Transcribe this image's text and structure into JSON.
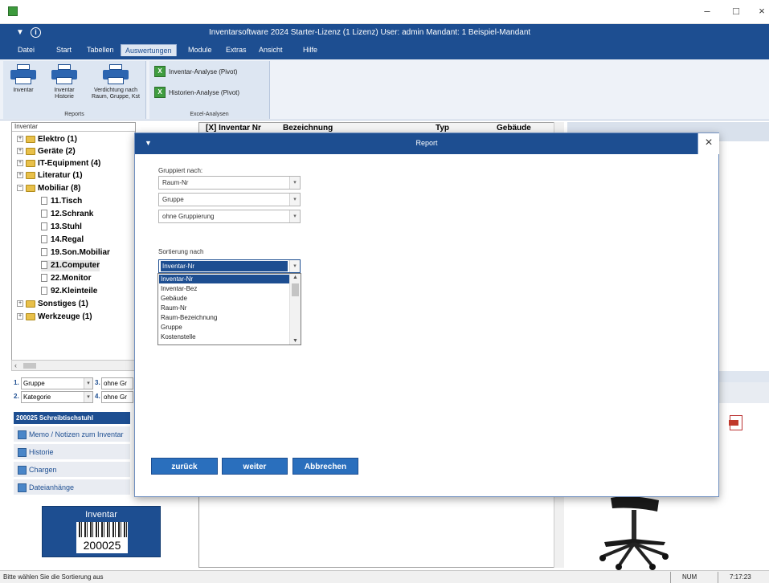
{
  "window": {
    "title": "Inventarsoftware 2024 Starter-Lizenz (1 Lizenz)   User: admin   Mandant: 1 Beispiel-Mandant",
    "minimize_glyph": "–",
    "maximize_glyph": "□",
    "close_glyph": "×"
  },
  "menu": {
    "items": [
      "Datei",
      "Start",
      "Tabellen",
      "Auswertungen",
      "Module",
      "Extras",
      "Ansicht",
      "Hilfe"
    ],
    "active": "Auswertungen"
  },
  "ribbon": {
    "reports": {
      "buttons": [
        {
          "label": "Inventar",
          "icon": "printer-icon"
        },
        {
          "label": "Inventar\nHistorie",
          "icon": "printer-icon"
        },
        {
          "label": "Verdichtung nach\nRaum, Gruppe, Kst",
          "icon": "printer-icon"
        }
      ],
      "group_label": "Reports"
    },
    "excel": {
      "buttons": [
        {
          "label": "Inventar-Analyse (Pivot)",
          "icon": "excel-icon"
        },
        {
          "label": "Historien-Analyse (Pivot)",
          "icon": "excel-icon"
        }
      ],
      "group_label": "Excel-Analysen"
    }
  },
  "tree": {
    "header": "Inventar",
    "nodes": [
      {
        "label": "Elektro  (1)",
        "level": 0,
        "expander": "+"
      },
      {
        "label": "Geräte  (2)",
        "level": 0,
        "expander": "+"
      },
      {
        "label": "IT-Equipment  (4)",
        "level": 0,
        "expander": "+"
      },
      {
        "label": "Literatur  (1)",
        "level": 0,
        "expander": "+"
      },
      {
        "label": "Mobiliar  (8)",
        "level": 0,
        "expander": "−"
      },
      {
        "label": "11.Tisch",
        "level": 1
      },
      {
        "label": "12.Schrank",
        "level": 1
      },
      {
        "label": "13.Stuhl",
        "level": 1
      },
      {
        "label": "14.Regal",
        "level": 1
      },
      {
        "label": "19.Son.Mobiliar",
        "level": 1
      },
      {
        "label": "21.Computer",
        "level": 1
      },
      {
        "label": "22.Monitor",
        "level": 1
      },
      {
        "label": "92.Kleinteile",
        "level": 1
      },
      {
        "label": "Sonstiges  (1)",
        "level": 0,
        "expander": "+"
      },
      {
        "label": "Werkzeuge  (1)",
        "level": 0,
        "expander": "+"
      }
    ]
  },
  "grouping": {
    "g1": {
      "num": "1.",
      "value": "Gruppe"
    },
    "g2": {
      "num": "2.",
      "value": "Kategorie"
    },
    "g3": {
      "num": "3.",
      "value": "ohne Gr"
    },
    "g4": {
      "num": "4.",
      "value": "ohne Gr"
    }
  },
  "detail": {
    "header": "200025 Schreibtischstuhl",
    "links": [
      "Memo / Notizen zum Inventar",
      "Historie",
      "Chargen",
      "Dateianhänge"
    ]
  },
  "barcode": {
    "title": "Inventar",
    "number": "200025"
  },
  "grid": {
    "columns": [
      "[X] Inventar Nr",
      "Bezeichnung",
      "Typ",
      "Gebäude"
    ]
  },
  "modal": {
    "title": "Report",
    "grouping_label": "Gruppiert nach:",
    "group_selects": [
      "Raum-Nr",
      "Gruppe",
      "ohne Gruppierung"
    ],
    "sort_label": "Sortierung nach",
    "sort_value": "Inventar-Nr",
    "sort_options": [
      "Inventar-Nr",
      "Inventar-Bez",
      "Gebäude",
      "Raum-Nr",
      "Raum-Bezeichnung",
      "Gruppe",
      "Kostenstelle"
    ],
    "buttons": {
      "back": "zurück",
      "next": "weiter",
      "cancel": "Abbrechen"
    }
  },
  "status": {
    "text": "Bitte wählen Sie die Sortierung aus",
    "num": "NUM",
    "time": "7:17:23"
  },
  "colors": {
    "primary": "#1d4e91",
    "button": "#2a6fbd",
    "ribbon": "#dde6f2",
    "folder": "#e8c04a",
    "excel": "#3f9c3f"
  }
}
